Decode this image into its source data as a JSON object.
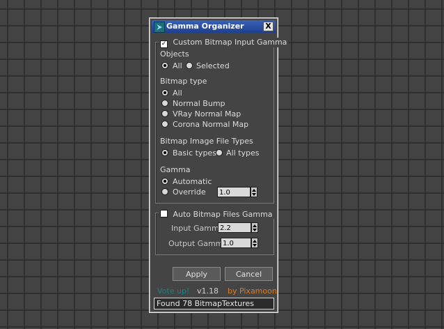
{
  "window": {
    "title": "Gamma Organizer",
    "close_label": "X"
  },
  "custom_group": {
    "checkbox_label": "Custom Bitmap Input Gamma",
    "checked": true,
    "objects": {
      "label": "Objects",
      "options": [
        "All",
        "Selected"
      ],
      "selected": "All"
    },
    "bitmap_type": {
      "label": "Bitmap type",
      "options": [
        "All",
        "Normal Bump",
        "VRay Normal Map",
        "Corona Normal Map"
      ],
      "selected": "All"
    },
    "file_types": {
      "label": "Bitmap Image File Types",
      "options": [
        "Basic types",
        "All types"
      ],
      "selected": "Basic types"
    },
    "gamma": {
      "label": "Gamma",
      "options": [
        "Automatic",
        "Override"
      ],
      "selected": "Automatic",
      "override_value": "1.0"
    }
  },
  "auto_group": {
    "checkbox_label": "Auto Bitmap Files Gamma",
    "checked": false,
    "input_gamma_label": "Input Gamma",
    "input_gamma_value": "2.2",
    "output_gamma_label": "Output Gamma",
    "output_gamma_value": "1.0"
  },
  "buttons": {
    "apply": "Apply",
    "cancel": "Cancel"
  },
  "footer": {
    "vote_link": "Vote up!",
    "version": "v1.18",
    "author_link": "by Pixamoon",
    "status": "Found 78 BitmapTextures"
  },
  "colors": {
    "vote_link": "#1c7f85",
    "author_link": "#e07a1c",
    "titlebar": "#2a4fa3"
  },
  "icons": [
    "app-logo-icon",
    "close-icon",
    "checkbox-checked",
    "radio-selected",
    "spinner-arrows"
  ]
}
